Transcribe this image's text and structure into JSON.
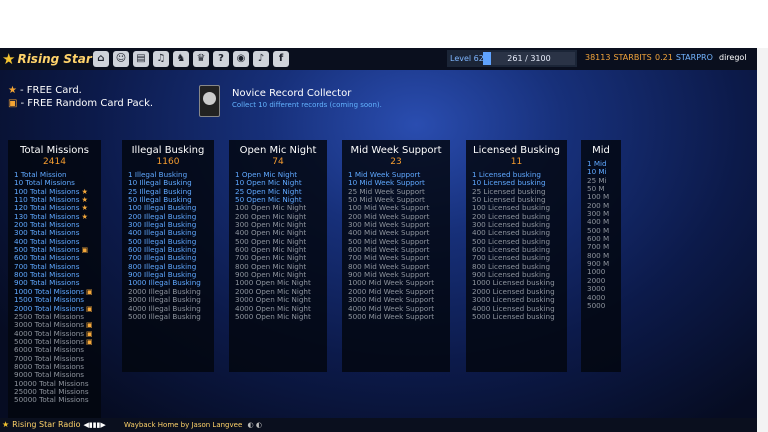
{
  "app": {
    "name": "Rising Star"
  },
  "nav": {
    "icons": [
      "home-icon",
      "face-icon",
      "cards-icon",
      "band-icon",
      "skills-icon",
      "trophy-icon",
      "help-icon",
      "discord-icon",
      "sound-icon",
      "facebook-icon"
    ]
  },
  "top": {
    "level_label": "Level",
    "level": "62",
    "xp": "261 / 3100",
    "xp_fraction": 0.084,
    "starbits_value": "38113",
    "starbits_label": "STARBITS",
    "starpro_value": "0.21",
    "starpro_label": "STARPRO",
    "username": "diregol"
  },
  "promo": {
    "line1": "- FREE Card.",
    "line2": "- FREE Random Card Pack."
  },
  "achievement": {
    "title": "Novice Record Collector",
    "desc": "Collect 10 different records (coming soon)."
  },
  "columns": [
    {
      "title": "Total Missions",
      "count": "2414",
      "items": [
        {
          "t": "1 Total Mission",
          "done": true,
          "bonus": ""
        },
        {
          "t": "10 Total Missions",
          "done": true,
          "bonus": ""
        },
        {
          "t": "100 Total Missions",
          "done": true,
          "bonus": "★"
        },
        {
          "t": "110 Total Missions",
          "done": true,
          "bonus": "★"
        },
        {
          "t": "120 Total Missions",
          "done": true,
          "bonus": "★"
        },
        {
          "t": "130 Total Missions",
          "done": true,
          "bonus": "★"
        },
        {
          "t": "200 Total Missions",
          "done": true,
          "bonus": ""
        },
        {
          "t": "300 Total Missions",
          "done": true,
          "bonus": ""
        },
        {
          "t": "400 Total Missions",
          "done": true,
          "bonus": ""
        },
        {
          "t": "500 Total Missions",
          "done": true,
          "bonus": "▣"
        },
        {
          "t": "600 Total Missions",
          "done": true,
          "bonus": ""
        },
        {
          "t": "700 Total Missions",
          "done": true,
          "bonus": ""
        },
        {
          "t": "800 Total Missions",
          "done": true,
          "bonus": ""
        },
        {
          "t": "900 Total Missions",
          "done": true,
          "bonus": ""
        },
        {
          "t": "1000 Total Missions",
          "done": true,
          "bonus": "▣"
        },
        {
          "t": "1500 Total Missions",
          "done": true,
          "bonus": ""
        },
        {
          "t": "2000 Total Missions",
          "done": true,
          "bonus": "▣"
        },
        {
          "t": "2500 Total Missions",
          "done": false,
          "bonus": ""
        },
        {
          "t": "3000 Total Missions",
          "done": false,
          "bonus": "▣"
        },
        {
          "t": "4000 Total Missions",
          "done": false,
          "bonus": "▣"
        },
        {
          "t": "5000 Total Missions",
          "done": false,
          "bonus": "▣"
        },
        {
          "t": "6000 Total Missions",
          "done": false,
          "bonus": ""
        },
        {
          "t": "7000 Total Missions",
          "done": false,
          "bonus": ""
        },
        {
          "t": "8000 Total Missions",
          "done": false,
          "bonus": ""
        },
        {
          "t": "9000 Total Missions",
          "done": false,
          "bonus": ""
        },
        {
          "t": "10000 Total Missions",
          "done": false,
          "bonus": ""
        },
        {
          "t": "25000 Total Missions",
          "done": false,
          "bonus": ""
        },
        {
          "t": "50000 Total Missions",
          "done": false,
          "bonus": ""
        }
      ]
    },
    {
      "title": "Illegal Busking",
      "count": "1160",
      "items": [
        {
          "t": "1 Illegal Busking",
          "done": true
        },
        {
          "t": "10 Illegal Busking",
          "done": true
        },
        {
          "t": "25 Illegal Busking",
          "done": true
        },
        {
          "t": "50 Illegal Busking",
          "done": true
        },
        {
          "t": "100 Illegal Busking",
          "done": true
        },
        {
          "t": "200 Illegal Busking",
          "done": true
        },
        {
          "t": "300 Illegal Busking",
          "done": true
        },
        {
          "t": "400 Illegal Busking",
          "done": true
        },
        {
          "t": "500 Illegal Busking",
          "done": true
        },
        {
          "t": "600 Illegal Busking",
          "done": true
        },
        {
          "t": "700 Illegal Busking",
          "done": true
        },
        {
          "t": "800 Illegal Busking",
          "done": true
        },
        {
          "t": "900 Illegal Busking",
          "done": true
        },
        {
          "t": "1000 Illegal Busking",
          "done": true
        },
        {
          "t": "2000 Illegal Busking",
          "done": false
        },
        {
          "t": "3000 Illegal Busking",
          "done": false
        },
        {
          "t": "4000 Illegal Busking",
          "done": false
        },
        {
          "t": "5000 Illegal Busking",
          "done": false
        }
      ]
    },
    {
      "title": "Open Mic Night",
      "count": "74",
      "items": [
        {
          "t": "1 Open Mic Night",
          "done": true
        },
        {
          "t": "10 Open Mic Night",
          "done": true
        },
        {
          "t": "25 Open Mic Night",
          "done": true
        },
        {
          "t": "50 Open Mic Night",
          "done": true
        },
        {
          "t": "100 Open Mic Night",
          "done": false
        },
        {
          "t": "200 Open Mic Night",
          "done": false
        },
        {
          "t": "300 Open Mic Night",
          "done": false
        },
        {
          "t": "400 Open Mic Night",
          "done": false
        },
        {
          "t": "500 Open Mic Night",
          "done": false
        },
        {
          "t": "600 Open Mic Night",
          "done": false
        },
        {
          "t": "700 Open Mic Night",
          "done": false
        },
        {
          "t": "800 Open Mic Night",
          "done": false
        },
        {
          "t": "900 Open Mic Night",
          "done": false
        },
        {
          "t": "1000 Open Mic Night",
          "done": false
        },
        {
          "t": "2000 Open Mic Night",
          "done": false
        },
        {
          "t": "3000 Open Mic Night",
          "done": false
        },
        {
          "t": "4000 Open Mic Night",
          "done": false
        },
        {
          "t": "5000 Open Mic Night",
          "done": false
        }
      ]
    },
    {
      "title": "Mid Week Support",
      "count": "23",
      "items": [
        {
          "t": "1 Mid Week Support",
          "done": true
        },
        {
          "t": "10 Mid Week Support",
          "done": true
        },
        {
          "t": "25 Mid Week Support",
          "done": false
        },
        {
          "t": "50 Mid Week Support",
          "done": false
        },
        {
          "t": "100 Mid Week Support",
          "done": false
        },
        {
          "t": "200 Mid Week Support",
          "done": false
        },
        {
          "t": "300 Mid Week Support",
          "done": false
        },
        {
          "t": "400 Mid Week Support",
          "done": false
        },
        {
          "t": "500 Mid Week Support",
          "done": false
        },
        {
          "t": "600 Mid Week Support",
          "done": false
        },
        {
          "t": "700 Mid Week Support",
          "done": false
        },
        {
          "t": "800 Mid Week Support",
          "done": false
        },
        {
          "t": "900 Mid Week Support",
          "done": false
        },
        {
          "t": "1000 Mid Week Support",
          "done": false
        },
        {
          "t": "2000 Mid Week Support",
          "done": false
        },
        {
          "t": "3000 Mid Week Support",
          "done": false
        },
        {
          "t": "4000 Mid Week Support",
          "done": false
        },
        {
          "t": "5000 Mid Week Support",
          "done": false
        }
      ]
    },
    {
      "title": "Licensed Busking",
      "count": "11",
      "items": [
        {
          "t": "1 Licensed busking",
          "done": true
        },
        {
          "t": "10 Licensed busking",
          "done": true
        },
        {
          "t": "25 Licensed busking",
          "done": false
        },
        {
          "t": "50 Licensed busking",
          "done": false
        },
        {
          "t": "100 Licensed busking",
          "done": false
        },
        {
          "t": "200 Licensed busking",
          "done": false
        },
        {
          "t": "300 Licensed busking",
          "done": false
        },
        {
          "t": "400 Licensed busking",
          "done": false
        },
        {
          "t": "500 Licensed busking",
          "done": false
        },
        {
          "t": "600 Licensed busking",
          "done": false
        },
        {
          "t": "700 Licensed busking",
          "done": false
        },
        {
          "t": "800 Licensed busking",
          "done": false
        },
        {
          "t": "900 Licensed busking",
          "done": false
        },
        {
          "t": "1000 Licensed busking",
          "done": false
        },
        {
          "t": "2000 Licensed busking",
          "done": false
        },
        {
          "t": "3000 Licensed busking",
          "done": false
        },
        {
          "t": "4000 Licensed busking",
          "done": false
        },
        {
          "t": "5000 Licensed busking",
          "done": false
        }
      ]
    },
    {
      "title": "Mid",
      "count": "",
      "items": [
        {
          "t": "1 Mid",
          "done": true
        },
        {
          "t": "10 Mi",
          "done": true
        },
        {
          "t": "25 Mi",
          "done": false
        },
        {
          "t": "50 M",
          "done": false
        },
        {
          "t": "100 M",
          "done": false
        },
        {
          "t": "200 M",
          "done": false
        },
        {
          "t": "300 M",
          "done": false
        },
        {
          "t": "400 M",
          "done": false
        },
        {
          "t": "500 M",
          "done": false
        },
        {
          "t": "600 M",
          "done": false
        },
        {
          "t": "700 M",
          "done": false
        },
        {
          "t": "800 M",
          "done": false
        },
        {
          "t": "900 M",
          "done": false
        },
        {
          "t": "1000",
          "done": false
        },
        {
          "t": "2000",
          "done": false
        },
        {
          "t": "3000",
          "done": false
        },
        {
          "t": "4000",
          "done": false
        },
        {
          "t": "5000",
          "done": false
        }
      ]
    }
  ],
  "radio": {
    "label": "Rising Star Radio",
    "now_playing": "Wayback Home by Jason Langvee"
  },
  "colors": {
    "accent": "#f39b2f",
    "done": "#5fa8ff",
    "pending": "#8e949d"
  }
}
